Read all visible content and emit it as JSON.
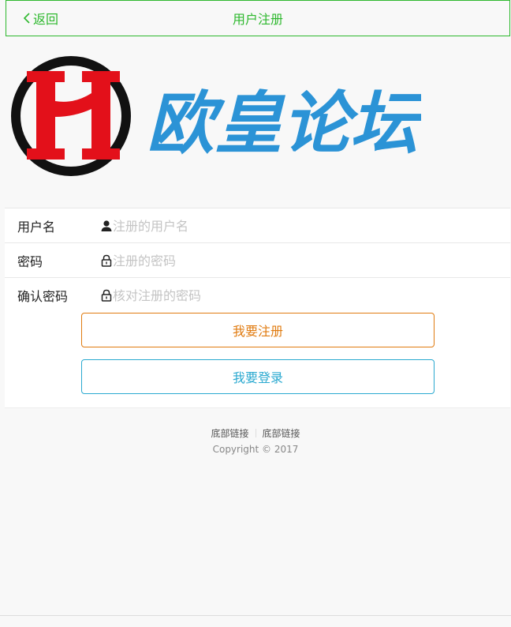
{
  "header": {
    "back_label": "返回",
    "title": "用户注册",
    "accent_color": "#2eb82e"
  },
  "logo": {
    "text": "欧皇论坛",
    "monogram": "H",
    "colors": {
      "red": "#e3101a",
      "ring": "#111111",
      "text": "#2b93d6"
    }
  },
  "form": {
    "username": {
      "label": "用户名",
      "icon": "user-icon",
      "placeholder": "注册的用户名",
      "value": ""
    },
    "password": {
      "label": "密码",
      "icon": "lock-icon",
      "placeholder": "注册的密码",
      "value": ""
    },
    "confirm": {
      "label": "确认密码",
      "icon": "lock-icon",
      "placeholder": "核对注册的密码",
      "value": ""
    }
  },
  "buttons": {
    "register": {
      "label": "我要注册",
      "color": "#e07b10"
    },
    "login": {
      "label": "我要登录",
      "color": "#2aa9d0"
    }
  },
  "footer": {
    "links": [
      "底部链接",
      "底部链接"
    ],
    "copyright": "Copyright © 2017"
  }
}
